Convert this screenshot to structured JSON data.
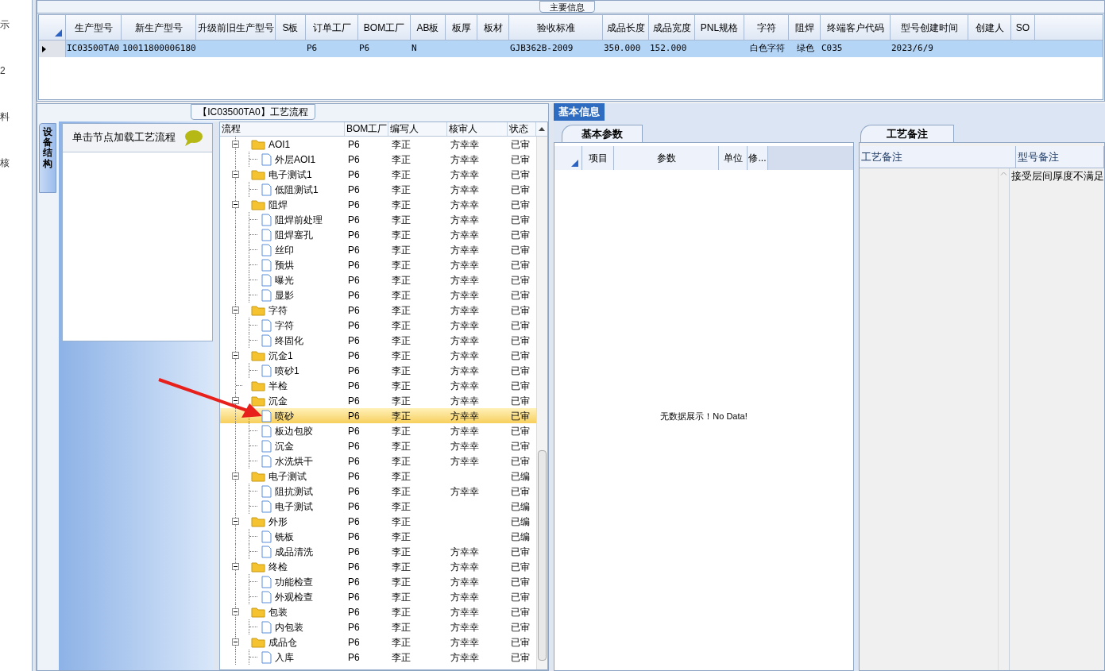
{
  "left_strip": [
    "示",
    "2",
    "料",
    "核"
  ],
  "main_info": {
    "title": "主要信息",
    "columns": [
      "生产型号",
      "新生产型号",
      "升级前旧生产型号",
      "S板",
      "订单工厂",
      "BOM工厂",
      "AB板",
      "板厚",
      "板材",
      "验收标准",
      "成品长度",
      "成品宽度",
      "PNL规格",
      "字符",
      "阻焊",
      "终端客户代码",
      "型号创建时间",
      "创建人",
      "SO"
    ],
    "rows": [
      {
        "selected": true,
        "cells": [
          "IC03500TA0",
          "10011800006180",
          null,
          null,
          "P6",
          "P6",
          "N",
          null,
          null,
          "GJB362B-2009",
          "350.000",
          "152.000",
          null,
          "白色字符",
          "绿色",
          "C035",
          "2023/6/9",
          null,
          null
        ]
      }
    ]
  },
  "dock": {
    "tab": "设备结构",
    "hint": "单击节点加载工艺流程"
  },
  "process": {
    "title": "【IC03500TA0】工艺流程",
    "columns": [
      "流程",
      "BOM工厂",
      "编写人",
      "核审人",
      "状态"
    ],
    "tree": [
      {
        "name": "AOI1",
        "bom": "P6",
        "writer": "李正",
        "reviewer": "方幸幸",
        "status": "已审",
        "selected": false,
        "children": [
          {
            "name": "外层AOI1",
            "bom": "P6",
            "writer": "李正",
            "reviewer": "方幸幸",
            "status": "已审",
            "selected": false
          }
        ]
      },
      {
        "name": "电子测试1",
        "bom": "P6",
        "writer": "李正",
        "reviewer": "方幸幸",
        "status": "已审",
        "selected": false,
        "children": [
          {
            "name": "低阻测试1",
            "bom": "P6",
            "writer": "李正",
            "reviewer": "方幸幸",
            "status": "已审",
            "selected": false
          }
        ]
      },
      {
        "name": "阻焊",
        "bom": "P6",
        "writer": "李正",
        "reviewer": "方幸幸",
        "status": "已审",
        "selected": false,
        "children": [
          {
            "name": "阻焊前处理",
            "bom": "P6",
            "writer": "李正",
            "reviewer": "方幸幸",
            "status": "已审",
            "selected": false
          },
          {
            "name": "阻焊塞孔",
            "bom": "P6",
            "writer": "李正",
            "reviewer": "方幸幸",
            "status": "已审",
            "selected": false
          },
          {
            "name": "丝印",
            "bom": "P6",
            "writer": "李正",
            "reviewer": "方幸幸",
            "status": "已审",
            "selected": false
          },
          {
            "name": "预烘",
            "bom": "P6",
            "writer": "李正",
            "reviewer": "方幸幸",
            "status": "已审",
            "selected": false
          },
          {
            "name": "曝光",
            "bom": "P6",
            "writer": "李正",
            "reviewer": "方幸幸",
            "status": "已审",
            "selected": false
          },
          {
            "name": "显影",
            "bom": "P6",
            "writer": "李正",
            "reviewer": "方幸幸",
            "status": "已审",
            "selected": false
          }
        ]
      },
      {
        "name": "字符",
        "bom": "P6",
        "writer": "李正",
        "reviewer": "方幸幸",
        "status": "已审",
        "selected": false,
        "children": [
          {
            "name": "字符",
            "bom": "P6",
            "writer": "李正",
            "reviewer": "方幸幸",
            "status": "已审",
            "selected": false
          },
          {
            "name": "终固化",
            "bom": "P6",
            "writer": "李正",
            "reviewer": "方幸幸",
            "status": "已审",
            "selected": false
          }
        ]
      },
      {
        "name": "沉金1",
        "bom": "P6",
        "writer": "李正",
        "reviewer": "方幸幸",
        "status": "已审",
        "selected": false,
        "children": [
          {
            "name": "喷砂1",
            "bom": "P6",
            "writer": "李正",
            "reviewer": "方幸幸",
            "status": "已审",
            "selected": false
          }
        ]
      },
      {
        "name": "半检",
        "bom": "P6",
        "writer": "李正",
        "reviewer": "方幸幸",
        "status": "已审",
        "selected": false
      },
      {
        "name": "沉金",
        "bom": "P6",
        "writer": "李正",
        "reviewer": "方幸幸",
        "status": "已审",
        "selected": false,
        "children": [
          {
            "name": "喷砂",
            "bom": "P6",
            "writer": "李正",
            "reviewer": "方幸幸",
            "status": "已审",
            "selected": true
          },
          {
            "name": "板边包胶",
            "bom": "P6",
            "writer": "李正",
            "reviewer": "方幸幸",
            "status": "已审",
            "selected": false
          },
          {
            "name": "沉金",
            "bom": "P6",
            "writer": "李正",
            "reviewer": "方幸幸",
            "status": "已审",
            "selected": false
          },
          {
            "name": "水洗烘干",
            "bom": "P6",
            "writer": "李正",
            "reviewer": "方幸幸",
            "status": "已审",
            "selected": false
          }
        ]
      },
      {
        "name": "电子测试",
        "bom": "P6",
        "writer": "李正",
        "status": "已编",
        "selected": false,
        "children": [
          {
            "name": "阻抗测试",
            "bom": "P6",
            "writer": "李正",
            "reviewer": "方幸幸",
            "status": "已审",
            "selected": false
          },
          {
            "name": "电子测试",
            "bom": "P6",
            "writer": "李正",
            "status": "已编",
            "selected": false
          }
        ]
      },
      {
        "name": "外形",
        "bom": "P6",
        "writer": "李正",
        "status": "已编",
        "selected": false,
        "children": [
          {
            "name": "铣板",
            "bom": "P6",
            "writer": "李正",
            "status": "已编",
            "selected": false
          },
          {
            "name": "成品清洗",
            "bom": "P6",
            "writer": "李正",
            "reviewer": "方幸幸",
            "status": "已审",
            "selected": false
          }
        ]
      },
      {
        "name": "终检",
        "bom": "P6",
        "writer": "李正",
        "reviewer": "方幸幸",
        "status": "已审",
        "selected": false,
        "children": [
          {
            "name": "功能检查",
            "bom": "P6",
            "writer": "李正",
            "reviewer": "方幸幸",
            "status": "已审",
            "selected": false
          },
          {
            "name": "外观检查",
            "bom": "P6",
            "writer": "李正",
            "reviewer": "方幸幸",
            "status": "已审",
            "selected": false
          }
        ]
      },
      {
        "name": "包装",
        "bom": "P6",
        "writer": "李正",
        "reviewer": "方幸幸",
        "status": "已审",
        "selected": false,
        "children": [
          {
            "name": "内包装",
            "bom": "P6",
            "writer": "李正",
            "reviewer": "方幸幸",
            "status": "已审",
            "selected": false
          }
        ]
      },
      {
        "name": "成品仓",
        "bom": "P6",
        "writer": "李正",
        "reviewer": "方幸幸",
        "status": "已审",
        "selected": false,
        "children": [
          {
            "name": "入库",
            "bom": "P6",
            "writer": "李正",
            "reviewer": "方幸幸",
            "status": "已审",
            "selected": false
          }
        ]
      }
    ]
  },
  "basic_info": {
    "tab": {
      "label": "基本信息",
      "selected": true
    },
    "params": {
      "tab": {
        "label": "基本参数",
        "selected": true
      },
      "columns": [
        "项目",
        "参数",
        "单位",
        "修..."
      ],
      "empty_text": "无数据展示！No Data!"
    },
    "remarks": {
      "tab": {
        "label": "工艺备注",
        "selected": true
      },
      "columns": [
        "工艺备注",
        "型号备注"
      ],
      "model_remark": "接受层间厚度不满足"
    }
  }
}
